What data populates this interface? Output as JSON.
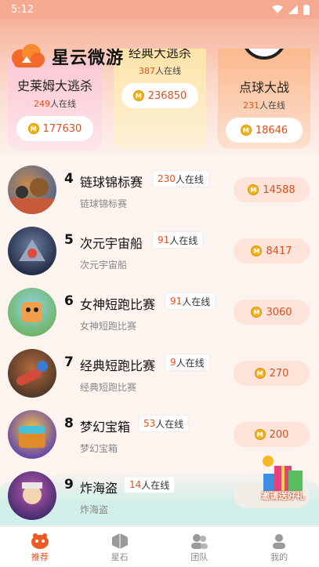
{
  "status": {
    "time": "5:12"
  },
  "brand": {
    "title": "星云微游"
  },
  "featured": [
    {
      "name": "史莱姆大逃杀",
      "online": "249",
      "online_suffix": "人在线",
      "price": "177630"
    },
    {
      "name": "经典大逃杀",
      "online": "387",
      "online_suffix": "人在线",
      "price": "236850"
    },
    {
      "name": "点球大战",
      "online": "231",
      "online_suffix": "人在线",
      "price": "18646"
    }
  ],
  "games": [
    {
      "rank": "4",
      "name": "链球锦标赛",
      "online": "230",
      "online_suffix": "人在线",
      "sub": "链球锦标赛",
      "price": "14588"
    },
    {
      "rank": "5",
      "name": "次元宇宙船",
      "online": "91",
      "online_suffix": "人在线",
      "sub": "次元宇宙船",
      "price": "8417"
    },
    {
      "rank": "6",
      "name": "女神短跑比赛",
      "online": "91",
      "online_suffix": "人在线",
      "sub": "女神短跑比赛",
      "price": "3060"
    },
    {
      "rank": "7",
      "name": "经典短跑比赛",
      "online": "9",
      "online_suffix": "人在线",
      "sub": "经典短跑比赛",
      "price": "270"
    },
    {
      "rank": "8",
      "name": "梦幻宝箱",
      "online": "53",
      "online_suffix": "人在线",
      "sub": "梦幻宝箱",
      "price": "200"
    },
    {
      "rank": "9",
      "name": "炸海盗",
      "online": "14",
      "online_suffix": "人在线",
      "sub": "炸海盗",
      "price": ""
    }
  ],
  "gift": {
    "label": "邀请送好礼"
  },
  "tabs": [
    {
      "label": "推荐",
      "icon": "recommend-icon",
      "active": true
    },
    {
      "label": "星石",
      "icon": "star-stone-icon",
      "active": false
    },
    {
      "label": "团队",
      "icon": "team-icon",
      "active": false
    },
    {
      "label": "我的",
      "icon": "profile-icon",
      "active": false
    }
  ],
  "colors": {
    "accent": "#e8501d",
    "coin": "#f2b21c",
    "pill_bg": "#fde3d9"
  }
}
